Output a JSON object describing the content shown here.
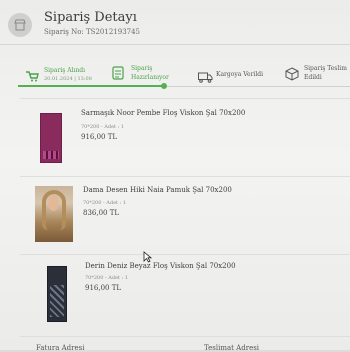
{
  "header": {
    "title": "Sipariş Detayı",
    "order_no": "Sipariş No: TS2012193745"
  },
  "steps": [
    {
      "label_line1": "Sipariş Alındı",
      "label_line2": "20.01.2024 | 13:08",
      "icon": "cart-icon",
      "state": "done"
    },
    {
      "label_line1": "Sipariş",
      "label_line2": "Hazırlanıyor",
      "icon": "clipboard-list-icon",
      "state": "done"
    },
    {
      "label_line1": "Kargoya Verildi",
      "label_line2": "",
      "icon": "truck-icon",
      "state": "pending"
    },
    {
      "label_line1": "Sipariş Teslim",
      "label_line2": "Edildi",
      "icon": "box-icon",
      "state": "pending"
    }
  ],
  "products": [
    {
      "name": "Sarmaşık Noor Pembe Floş Viskon Şal 70x200",
      "meta": "70*200 - Adet : 1",
      "price": "916,00 TL",
      "image": "pink-scarf"
    },
    {
      "name": "Dama Desen Hiki Naia Pamuk Şal 70x200",
      "meta": "70*200 - Adet : 1",
      "price": "836,00 TL",
      "image": "hijab-model-photo"
    },
    {
      "name": "Derin Deniz Beyaz Floş Viskon Şal 70x200",
      "meta": "70*200 - Adet : 1",
      "price": "916,00 TL",
      "image": "navy-scarf"
    }
  ],
  "footer": {
    "left": "Fatura Adresi",
    "right": "Teslimat Adresi"
  },
  "colors": {
    "accent": "#4aa24a",
    "text": "#3a3a3a"
  }
}
